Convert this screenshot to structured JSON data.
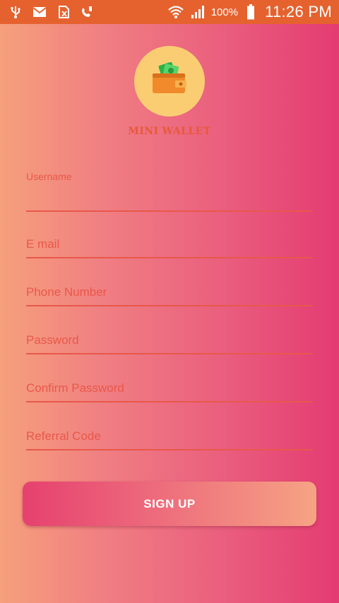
{
  "status_bar": {
    "battery_percent": "100%",
    "time": "11:26 PM",
    "left_icons": [
      "usb-icon",
      "gmail-icon",
      "sim-card-icon",
      "missed-call-icon"
    ],
    "right_icons": [
      "wifi-icon",
      "signal-icon",
      "battery-icon"
    ]
  },
  "app": {
    "title": "MINI WALLET",
    "logo_icon": "wallet-icon"
  },
  "form": {
    "username_label": "Username",
    "email_label": "E mail",
    "phone_label": "Phone Number",
    "password_label": "Password",
    "confirm_password_label": "Confirm Password",
    "referral_label": "Referral Code",
    "signup_label": "SIGN UP"
  },
  "colors": {
    "status_bar": "#e5622f",
    "accent": "#e8584a",
    "logo_bg": "#fbcd73",
    "gradient_left": "#f6a07c",
    "gradient_right": "#e43b72"
  }
}
